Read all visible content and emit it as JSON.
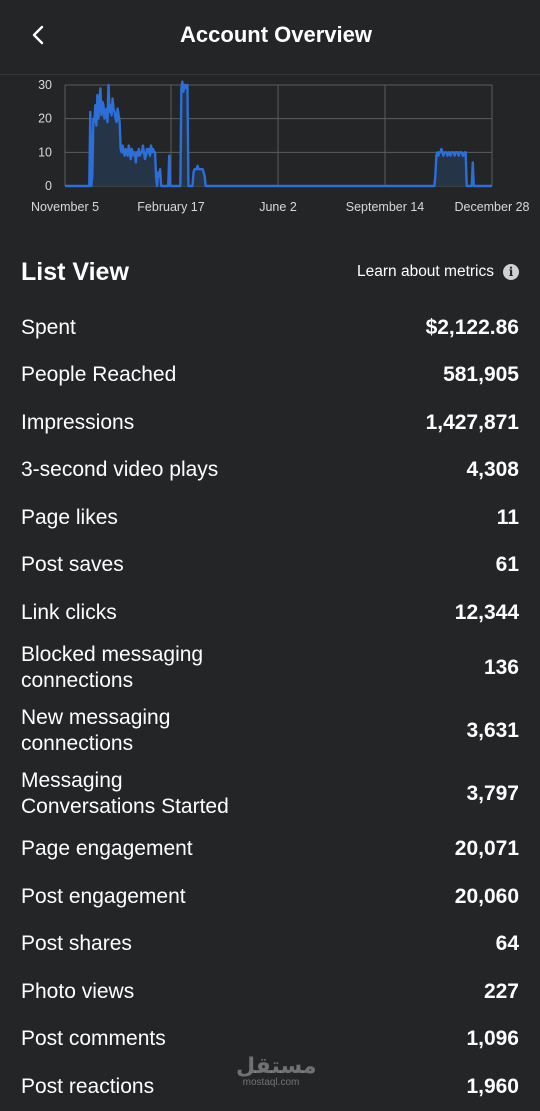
{
  "header": {
    "title": "Account Overview"
  },
  "chart_data": {
    "type": "line",
    "x_tick_labels": [
      "November 5",
      "February 17",
      "June 2",
      "September 14",
      "December 28"
    ],
    "y_ticks": [
      0,
      10,
      20,
      30
    ],
    "ylim": [
      0,
      30
    ],
    "grid": true,
    "series": [
      {
        "values": [
          0,
          0,
          0,
          0,
          0,
          0,
          0,
          0,
          0,
          0,
          0,
          0,
          0,
          0,
          0,
          0,
          0,
          0,
          0,
          0,
          0,
          0,
          0,
          0,
          0,
          22,
          0,
          3,
          20,
          19,
          24,
          18,
          27,
          20,
          25,
          29,
          21,
          25,
          24,
          20,
          22,
          23,
          19,
          30,
          22,
          24,
          21,
          26,
          23,
          22,
          20,
          19,
          23,
          21,
          19,
          11,
          10,
          12,
          10,
          9,
          11,
          10,
          9,
          12,
          10,
          8,
          11,
          10,
          9,
          10,
          7,
          10,
          9,
          11,
          9,
          10,
          10,
          12,
          10,
          8,
          9,
          11,
          10,
          11,
          9,
          12,
          10,
          11,
          10,
          10,
          3,
          0,
          4,
          3,
          5,
          0,
          0,
          0,
          0,
          0,
          0,
          0,
          0,
          9,
          0,
          0,
          0,
          0,
          0,
          0,
          0,
          0,
          0,
          0,
          0,
          29,
          31,
          28,
          30,
          30,
          29,
          30,
          0,
          0,
          0,
          0,
          0,
          4,
          5,
          5,
          5,
          6,
          5,
          5,
          5,
          5,
          5,
          4,
          3,
          0,
          0,
          0,
          0,
          0,
          0,
          0,
          0,
          0,
          0,
          0,
          0,
          0,
          0,
          0,
          0,
          0,
          0,
          0,
          0,
          0,
          0,
          0,
          0,
          0,
          0,
          0,
          0,
          0,
          0,
          0,
          0,
          0,
          0,
          0,
          0,
          0,
          0,
          0,
          0,
          0,
          0,
          0,
          0,
          0,
          0,
          0,
          0,
          0,
          0,
          0,
          0,
          0,
          0,
          0,
          0,
          0,
          0,
          0,
          0,
          0,
          0,
          0,
          0,
          0,
          0,
          0,
          0,
          0,
          0,
          0,
          0,
          0,
          0,
          0,
          0,
          0,
          0,
          0,
          0,
          0,
          0,
          0,
          0,
          0,
          0,
          0,
          0,
          0,
          0,
          0,
          0,
          0,
          0,
          0,
          0,
          0,
          0,
          0,
          0,
          0,
          0,
          0,
          0,
          0,
          0,
          0,
          0,
          0,
          0,
          0,
          0,
          0,
          0,
          0,
          0,
          0,
          0,
          0,
          0,
          0,
          0,
          0,
          0,
          0,
          0,
          0,
          0,
          0,
          0,
          0,
          0,
          0,
          0,
          0,
          0,
          0,
          0,
          0,
          0,
          0,
          0,
          0,
          0,
          0,
          0,
          0,
          0,
          0,
          0,
          0,
          0,
          0,
          0,
          0,
          0,
          0,
          0,
          0,
          0,
          0,
          0,
          0,
          0,
          0,
          0,
          0,
          0,
          0,
          0,
          0,
          0,
          0,
          0,
          0,
          0,
          0,
          0,
          0,
          0,
          0,
          0,
          0,
          0,
          0,
          0,
          0,
          0,
          0,
          0,
          0,
          0,
          0,
          0,
          0,
          0,
          0,
          0,
          0,
          0,
          0,
          0,
          0,
          0,
          0,
          0,
          0,
          0,
          0,
          0,
          0,
          0,
          0,
          0,
          0,
          0,
          0,
          0,
          0,
          0,
          0,
          0,
          0,
          0,
          0,
          0,
          0,
          3,
          9,
          10,
          9,
          10,
          10,
          11,
          10,
          9,
          10,
          10,
          10,
          9,
          10,
          10,
          9,
          10,
          10,
          10,
          9,
          10,
          10,
          10,
          9,
          10,
          10,
          10,
          9,
          9,
          10,
          10,
          0,
          0,
          0,
          0,
          0,
          0,
          7,
          0,
          0,
          0,
          0,
          0,
          0,
          0,
          0,
          0,
          0,
          0,
          0,
          0,
          0,
          0,
          0,
          0,
          0,
          0
        ]
      }
    ],
    "line_color": "#2d6fd6",
    "fill_color": "#263447"
  },
  "list": {
    "title": "List View",
    "learn_label": "Learn about metrics",
    "info_icon": "info-icon",
    "rows": [
      {
        "label": "Spent",
        "value": "$2,122.86"
      },
      {
        "label": "People Reached",
        "value": "581,905"
      },
      {
        "label": "Impressions",
        "value": "1,427,871"
      },
      {
        "label": "3-second video plays",
        "value": "4,308"
      },
      {
        "label": "Page likes",
        "value": "11"
      },
      {
        "label": "Post saves",
        "value": "61"
      },
      {
        "label": "Link clicks",
        "value": "12,344"
      },
      {
        "label": "Blocked messaging connections",
        "value": "136"
      },
      {
        "label": "New messaging connections",
        "value": "3,631"
      },
      {
        "label": "Messaging Conversations Started",
        "value": "3,797"
      },
      {
        "label": "Page engagement",
        "value": "20,071"
      },
      {
        "label": "Post engagement",
        "value": "20,060"
      },
      {
        "label": "Post shares",
        "value": "64"
      },
      {
        "label": "Photo views",
        "value": "227"
      },
      {
        "label": "Post comments",
        "value": "1,096"
      },
      {
        "label": "Post reactions",
        "value": "1,960"
      }
    ]
  },
  "watermark": {
    "arabic": "مستقل",
    "latin": "mostaql.com"
  }
}
